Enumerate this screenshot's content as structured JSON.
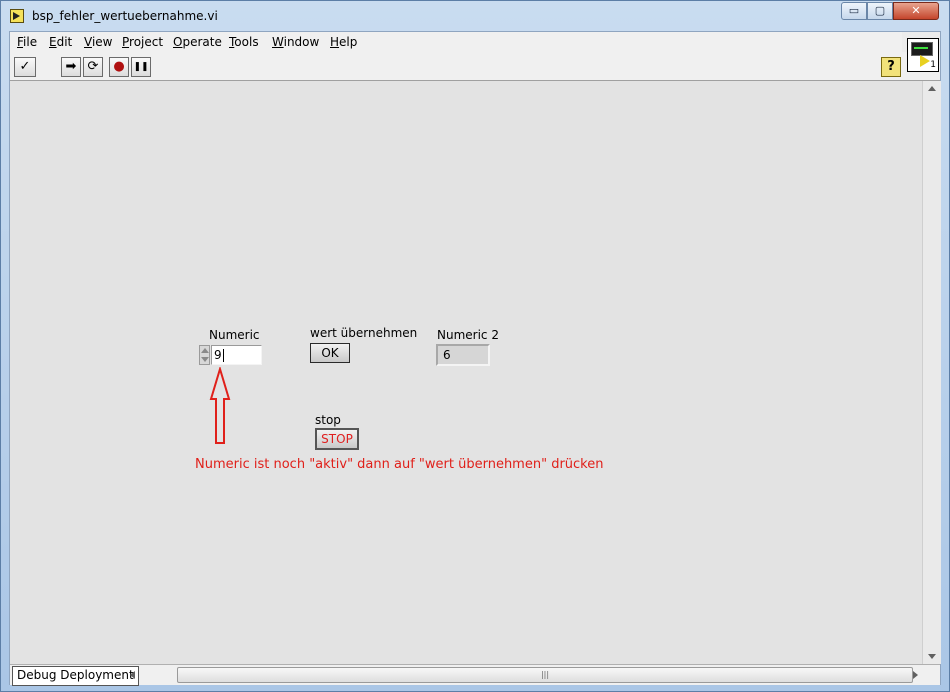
{
  "window": {
    "title": "bsp_fehler_wertuebernahme.vi",
    "min_glyph": "▭",
    "max_glyph": "▢",
    "close_glyph": "✕"
  },
  "menu": [
    {
      "underline": "F",
      "rest": "ile"
    },
    {
      "underline": "E",
      "rest": "dit"
    },
    {
      "underline": "V",
      "rest": "iew"
    },
    {
      "underline": "P",
      "rest": "roject"
    },
    {
      "underline": "O",
      "rest": "perate"
    },
    {
      "underline": "T",
      "rest": "ools"
    },
    {
      "underline": "W",
      "rest": "indow"
    },
    {
      "underline": "H",
      "rest": "elp"
    }
  ],
  "toolbar": {
    "check_glyph": "✓",
    "run_glyph": "➡",
    "run_cont_glyph": "⟳",
    "abort_glyph": "●",
    "pause_glyph": "❚❚",
    "help_glyph": "?"
  },
  "vi_icon": {
    "number": "1"
  },
  "controls": {
    "numeric_label": "Numeric",
    "numeric_value": "9",
    "button_label": "wert übernehmen",
    "button_text": "OK",
    "numeric2_label": "Numeric 2",
    "numeric2_value": "6",
    "stop_label": "stop",
    "stop_text": "STOP"
  },
  "annotation": {
    "text": "Numeric ist noch \"aktiv\" dann auf \"wert übernehmen\" drücken",
    "color": "#e0201a"
  },
  "status": {
    "context": "Debug Deployment",
    "scroll_grip": "|||"
  }
}
